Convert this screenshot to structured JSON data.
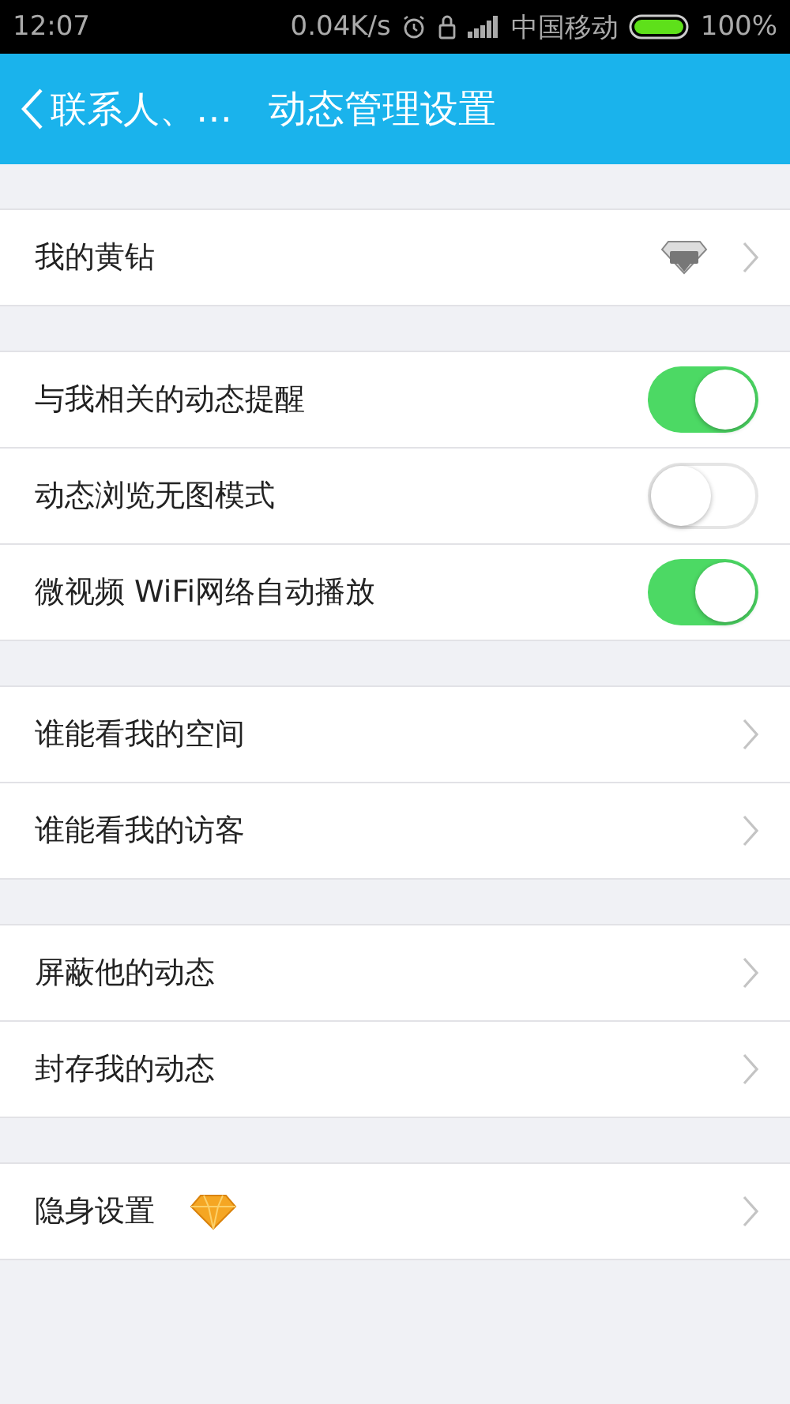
{
  "status_bar": {
    "time": "12:07",
    "speed": "0.04K/s",
    "carrier": "中国移动",
    "battery": "100%"
  },
  "header": {
    "back_label": "联系人、…",
    "title": "动态管理设置"
  },
  "groups": [
    {
      "rows": [
        {
          "kind": "badge-link",
          "label": "我的黄钻"
        }
      ]
    },
    {
      "rows": [
        {
          "kind": "toggle",
          "label": "与我相关的动态提醒",
          "on": true
        },
        {
          "kind": "toggle",
          "label": "动态浏览无图模式",
          "on": false
        },
        {
          "kind": "toggle",
          "label": "微视频 WiFi网络自动播放",
          "on": true
        }
      ]
    },
    {
      "rows": [
        {
          "kind": "link",
          "label": "谁能看我的空间"
        },
        {
          "kind": "link",
          "label": "谁能看我的访客"
        }
      ]
    },
    {
      "rows": [
        {
          "kind": "link",
          "label": "屏蔽他的动态"
        },
        {
          "kind": "link",
          "label": "封存我的动态"
        }
      ]
    },
    {
      "rows": [
        {
          "kind": "gem-link",
          "label": "隐身设置"
        }
      ]
    }
  ]
}
